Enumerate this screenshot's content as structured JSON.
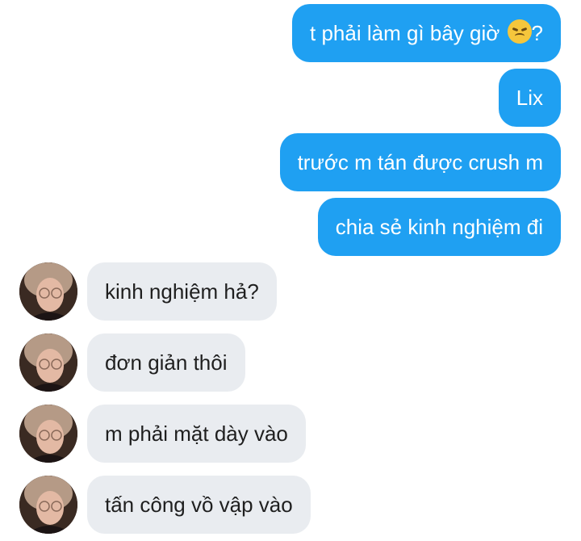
{
  "messages": [
    {
      "dir": "out",
      "text": "t phải làm gì bây giờ",
      "emoji": "disappointed-face"
    },
    {
      "dir": "out",
      "text": "Lix"
    },
    {
      "dir": "out",
      "text": "trước m tán được crush m"
    },
    {
      "dir": "out",
      "text": "chia sẻ kinh nghiệm đi"
    },
    {
      "dir": "in",
      "text": "kinh nghiệm hả?"
    },
    {
      "dir": "in",
      "text": "đơn giản thôi"
    },
    {
      "dir": "in",
      "text": "m phải mặt dày vào"
    },
    {
      "dir": "in",
      "text": "tấn công vồ vập vào"
    }
  ],
  "emoji_suffix": "?",
  "colors": {
    "outgoing_bubble": "#1fa0f2",
    "incoming_bubble": "#e9ecf0"
  }
}
